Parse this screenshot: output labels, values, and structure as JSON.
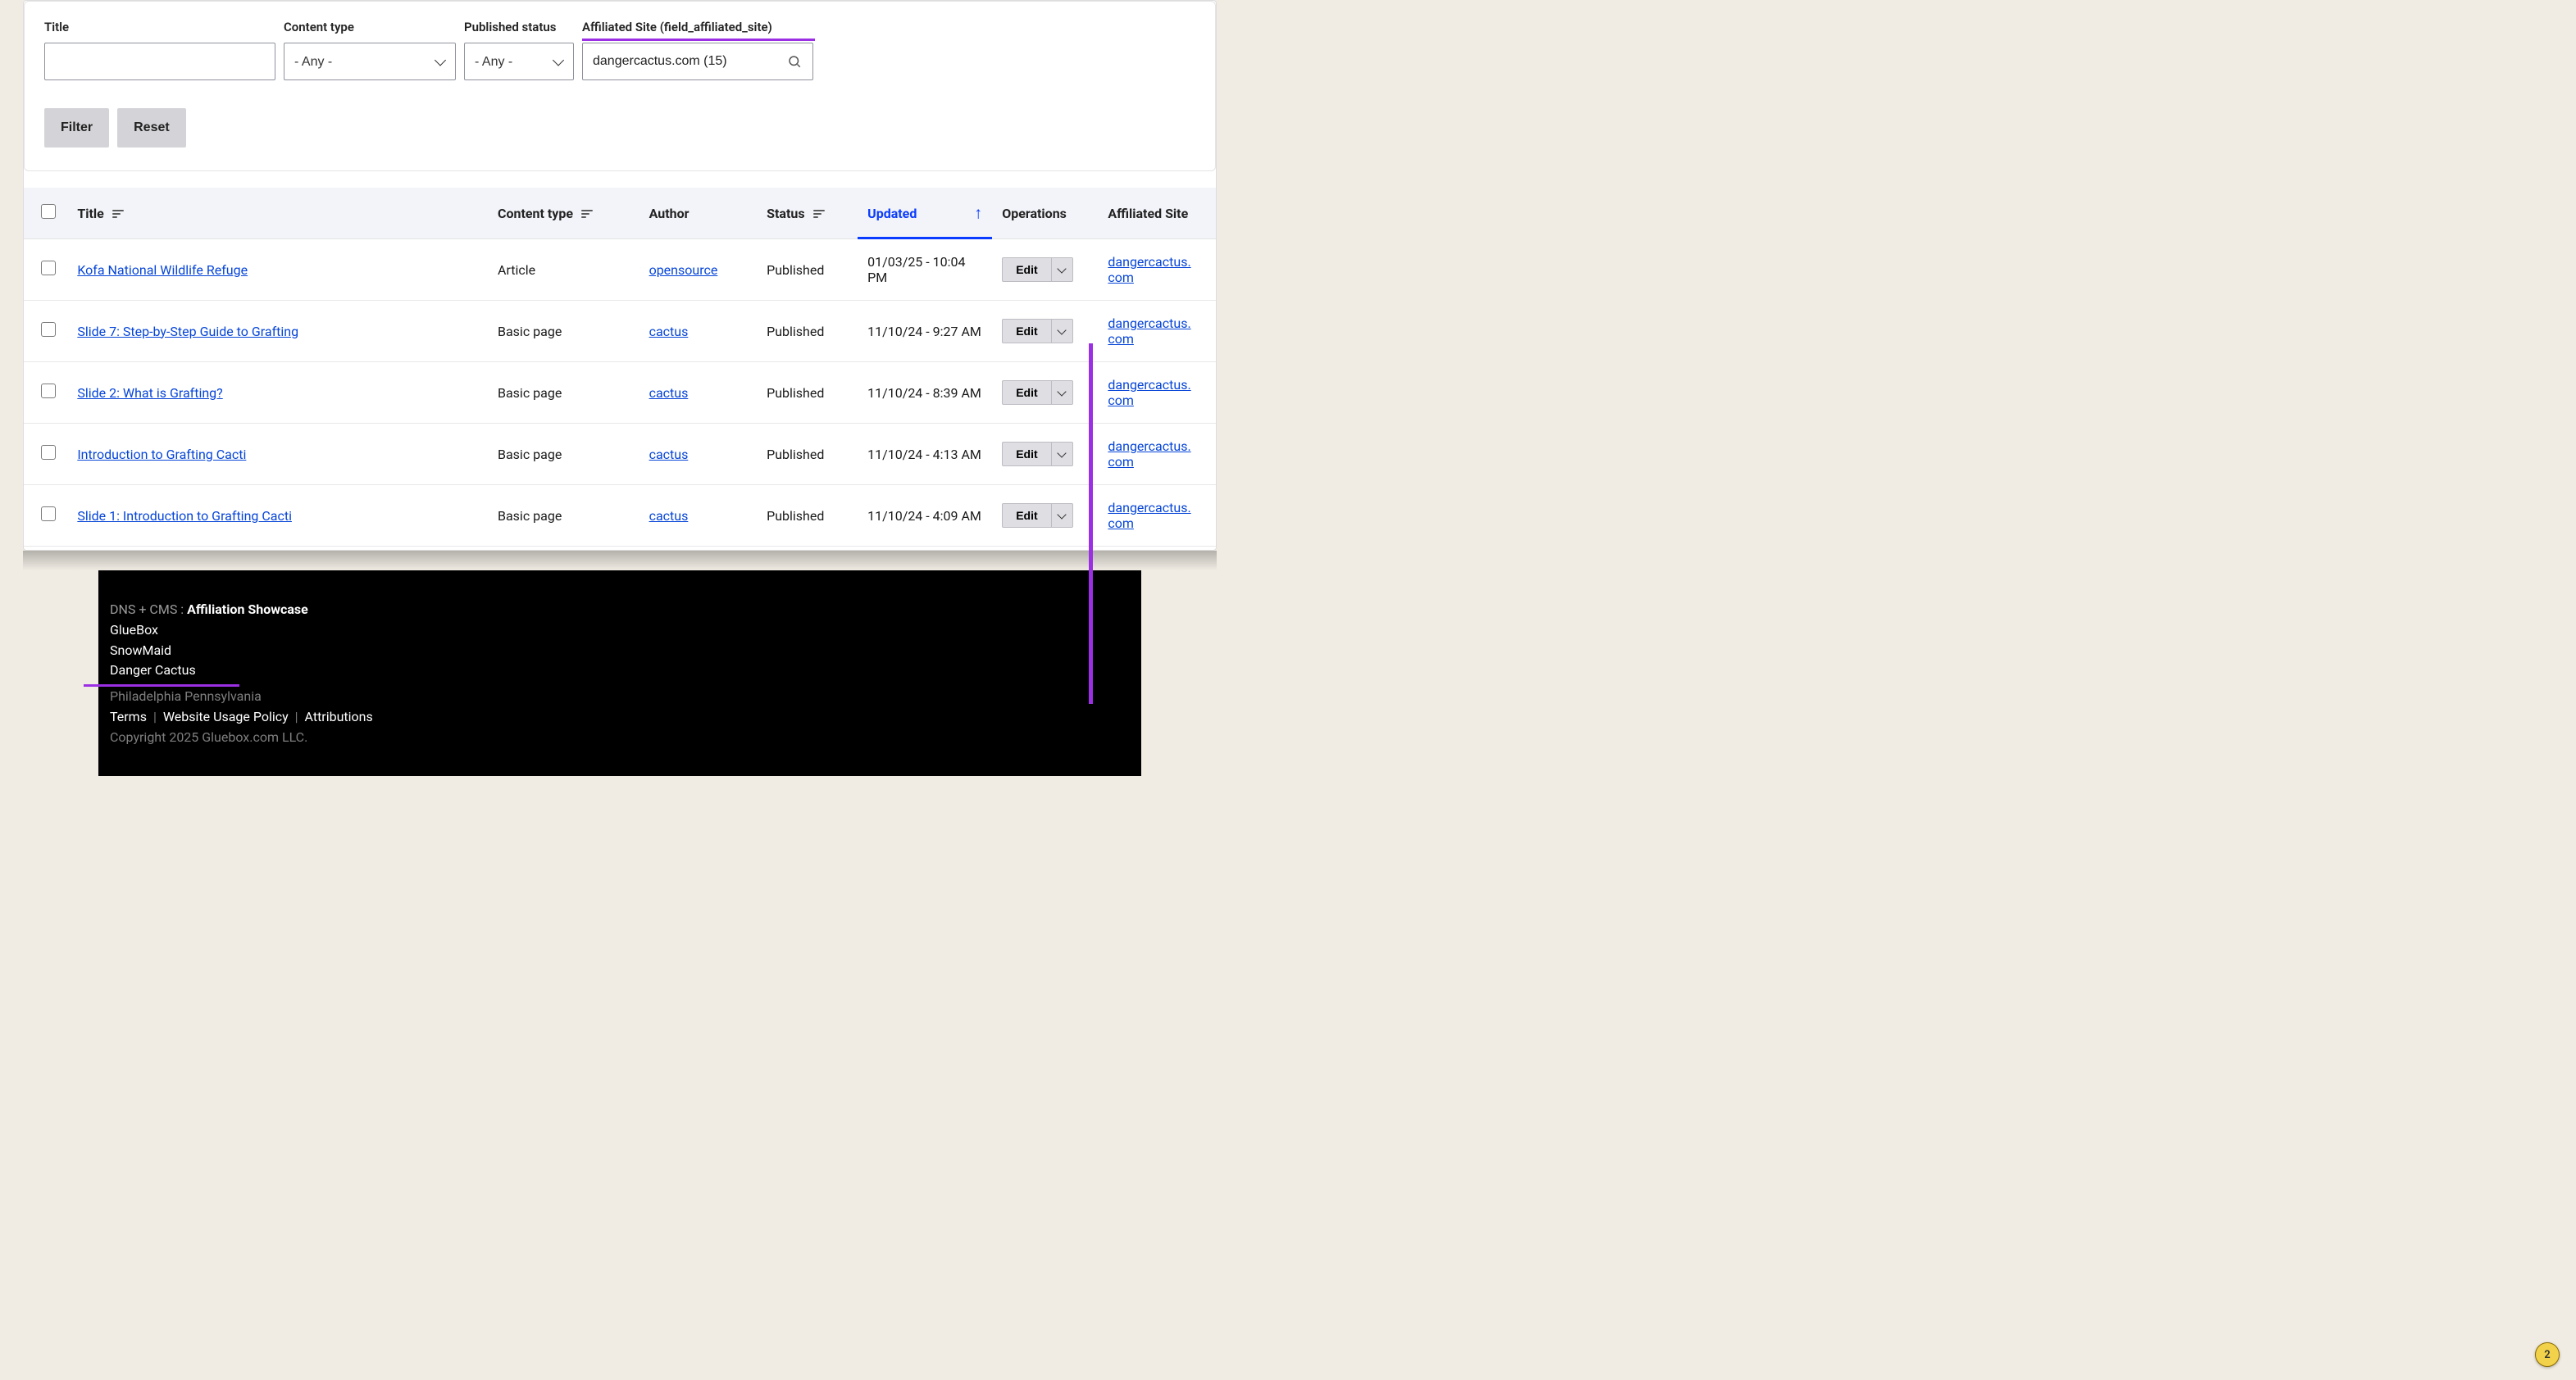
{
  "filters": {
    "title_label": "Title",
    "title_value": "",
    "ctype_label": "Content type",
    "ctype_value": "- Any -",
    "pubstatus_label": "Published status",
    "pubstatus_value": "- Any -",
    "affsite_label": "Affiliated Site (field_affiliated_site)",
    "affsite_value": "dangercactus.com (15)",
    "filter_btn": "Filter",
    "reset_btn": "Reset"
  },
  "columns": {
    "title": "Title",
    "ctype": "Content type",
    "author": "Author",
    "status": "Status",
    "updated": "Updated",
    "ops": "Operations",
    "affsite": "Affiliated Site"
  },
  "edit_label": "Edit",
  "rows": [
    {
      "title": "Kofa National Wildlife Refuge",
      "ctype": "Article",
      "author": "opensource",
      "status": "Published",
      "updated": "01/03/25 - 10:04 PM",
      "affsite": "dangercactus.com"
    },
    {
      "title": "Slide 7: Step-by-Step Guide to Grafting",
      "ctype": "Basic page",
      "author": "cactus",
      "status": "Published",
      "updated": "11/10/24 - 9:27 AM",
      "affsite": "dangercactus.com"
    },
    {
      "title": "Slide 2: What is Grafting?",
      "ctype": "Basic page",
      "author": "cactus",
      "status": "Published",
      "updated": "11/10/24 - 8:39 AM",
      "affsite": "dangercactus.com"
    },
    {
      "title": "Introduction to Grafting Cacti",
      "ctype": "Basic page",
      "author": "cactus",
      "status": "Published",
      "updated": "11/10/24 - 4:13 AM",
      "affsite": "dangercactus.com"
    },
    {
      "title": "Slide 1: Introduction to Grafting Cacti",
      "ctype": "Basic page",
      "author": "cactus",
      "status": "Published",
      "updated": "11/10/24 - 4:09 AM",
      "affsite": "dangercactus.com"
    }
  ],
  "footer": {
    "prefix": "DNS + CMS : ",
    "heading": "Affiliation Showcase",
    "links": [
      "GlueBox",
      "SnowMaid",
      "Danger Cactus"
    ],
    "location": "Philadelphia Pennsylvania",
    "legal": [
      "Terms",
      "Website Usage Policy",
      "Attributions"
    ],
    "copyright": "Copyright 2025 Gluebox.com LLC."
  },
  "badge": "2"
}
